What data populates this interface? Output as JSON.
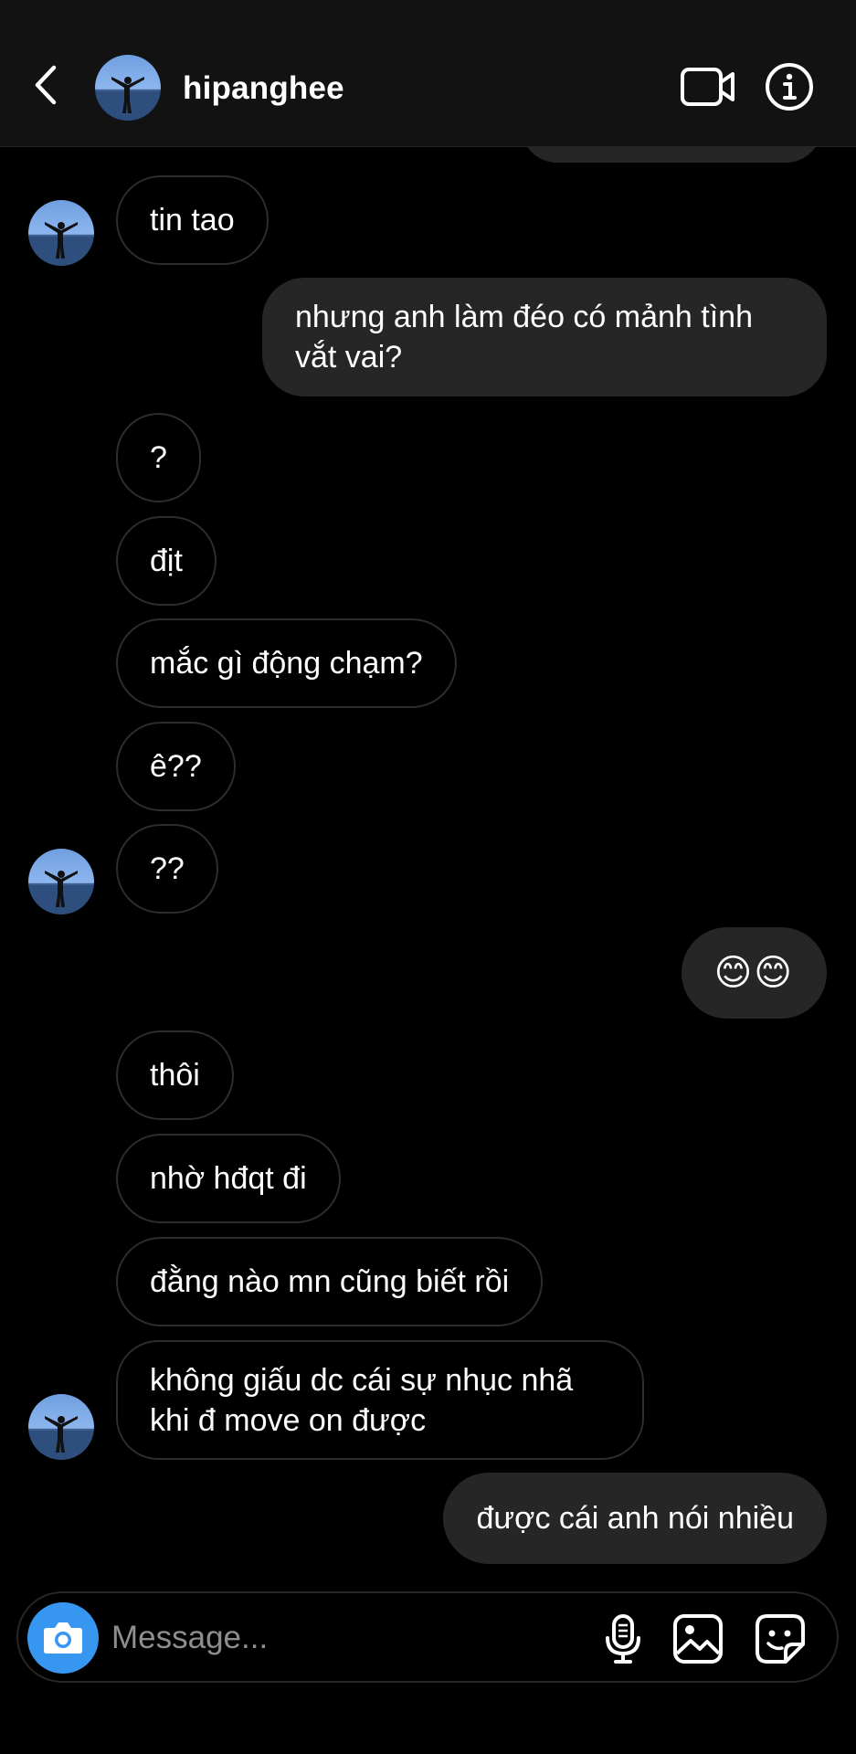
{
  "header": {
    "username": "hipanghee",
    "back_icon": "chevron-left-icon",
    "video_icon": "video-camera-icon",
    "info_icon": "info-icon"
  },
  "messages": [
    {
      "direction": "incoming",
      "text": "tin tao"
    },
    {
      "direction": "outgoing",
      "text": "nhưng anh làm đéo có mảnh tình vắt vai?"
    },
    {
      "direction": "incoming",
      "text": "?"
    },
    {
      "direction": "incoming",
      "text": "địt"
    },
    {
      "direction": "incoming",
      "text": "mắc gì động chạm?"
    },
    {
      "direction": "incoming",
      "text": "ê??"
    },
    {
      "direction": "incoming",
      "text": "??"
    },
    {
      "direction": "outgoing",
      "text": "😊😊"
    },
    {
      "direction": "incoming",
      "text": "thôi"
    },
    {
      "direction": "incoming",
      "text": "nhờ hđqt đi"
    },
    {
      "direction": "incoming",
      "text": "đằng nào mn cũng biết rồi"
    },
    {
      "direction": "incoming",
      "text": "không giấu dc cái sự nhục nhã khi đ move on được"
    },
    {
      "direction": "outgoing",
      "text": "được cái anh nói nhiều"
    }
  ],
  "composer": {
    "placeholder": "Message...",
    "value": "",
    "camera_icon": "camera-icon",
    "mic_icon": "microphone-icon",
    "gallery_icon": "gallery-icon",
    "sticker_icon": "sticker-icon",
    "accent_color": "#3797f0"
  },
  "colors": {
    "background": "#000000",
    "header_background": "#121212",
    "outgoing_bubble": "#262626",
    "incoming_border": "#2d2d2d"
  }
}
